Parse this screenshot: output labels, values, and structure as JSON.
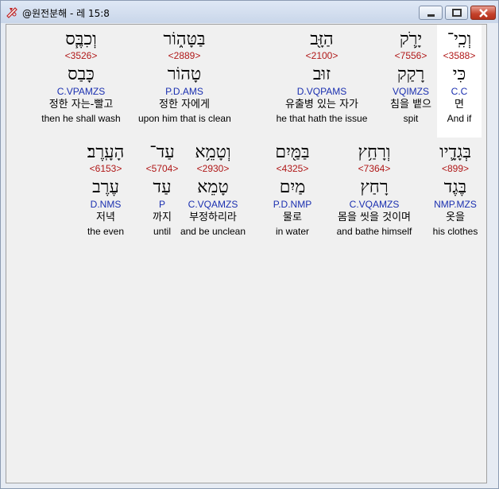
{
  "window": {
    "title": "@원전분해 - 레 15:8"
  },
  "rows": [
    {
      "words": [
        {
          "hebrew": "וְכִֽי־",
          "strong": "<3588>",
          "lemma": "כִּי",
          "parse": "C.C",
          "korean": "면",
          "english": "And if",
          "highlighted": true
        },
        {
          "hebrew": "יָרֹ֛ק",
          "strong": "<7556>",
          "lemma": "רָקַק",
          "parse": "VQIMZS",
          "korean": "침을 뱉으",
          "english": "spit",
          "highlighted": false
        },
        {
          "hebrew": "הַזָּ֖ב",
          "strong": "<2100>",
          "lemma": "זוּב",
          "parse": "D.VQPAMS",
          "korean": "유출병 있는 자가",
          "english": "he that hath the issue",
          "highlighted": false
        },
        {
          "hebrew": "בַּטָּה֑וֹר",
          "strong": "<2889>",
          "lemma": "טָהוֹר",
          "parse": "P.D.AMS",
          "korean": "정한 자에게",
          "english": "upon him that is clean",
          "highlighted": false
        },
        {
          "hebrew": "וְכִבֶּ֧ס",
          "strong": "<3526>",
          "lemma": "כָּבַס",
          "parse": "C.VPAMZS",
          "korean": "정한 자는-빨고",
          "english": "then he shall wash",
          "highlighted": false
        }
      ]
    },
    {
      "words": [
        {
          "hebrew": "בְּגָדָ֛יו",
          "strong": "<899>",
          "lemma": "בֶּגֶד",
          "parse": "NMP.MZS",
          "korean": "옷을",
          "english": "his clothes",
          "highlighted": false
        },
        {
          "hebrew": "וְרָחַ֥ץ",
          "strong": "<7364>",
          "lemma": "רָחַץ",
          "parse": "C.VQAMZS",
          "korean": "몸을 씻을 것이며",
          "english": "and bathe himself",
          "highlighted": false
        },
        {
          "hebrew": "בַּמַּ֖יִם",
          "strong": "<4325>",
          "lemma": "מַיִם",
          "parse": "P.D.NMP",
          "korean": "물로",
          "english": "in water",
          "highlighted": false
        },
        {
          "hebrew": "וְטָמֵ֥א",
          "strong": "<2930>",
          "lemma": "טָמֵא",
          "parse": "C.VQAMZS",
          "korean": "부정하리라",
          "english": "and be unclean",
          "highlighted": false
        },
        {
          "hebrew": "עַד־",
          "strong": "<5704>",
          "lemma": "עַד",
          "parse": "P",
          "korean": "까지",
          "english": "until",
          "highlighted": false
        },
        {
          "hebrew": "הָעָֽרֶב׃",
          "strong": "<6153>",
          "lemma": "עֶרֶב",
          "parse": "D.NMS",
          "korean": "저녁",
          "english": "the even",
          "highlighted": false
        }
      ]
    }
  ]
}
